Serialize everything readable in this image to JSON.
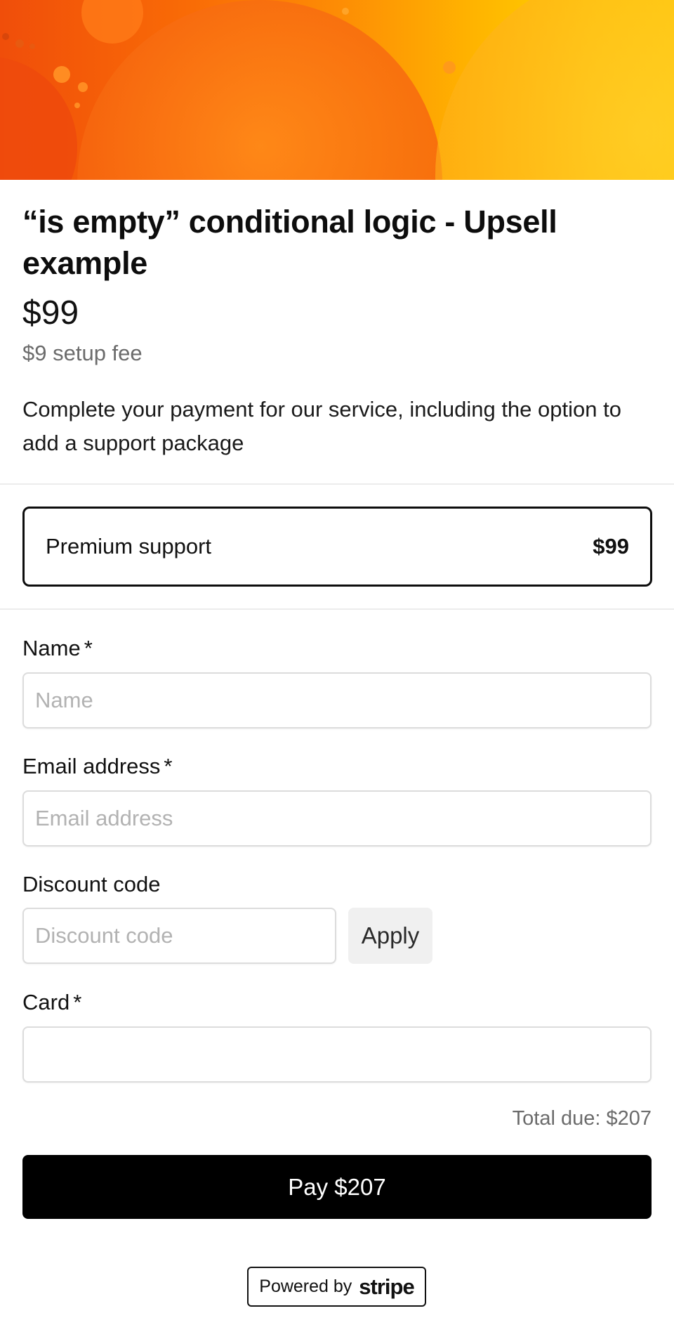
{
  "product": {
    "title": "“is empty” conditional logic - Upsell example",
    "price": "$99",
    "setup_fee": "$9 setup fee",
    "description": "Complete your payment for our service, including the option to add a support package"
  },
  "upsell": {
    "label": "Premium support",
    "price": "$99"
  },
  "form": {
    "name": {
      "label": "Name",
      "required_mark": "*",
      "placeholder": "Name",
      "value": ""
    },
    "email": {
      "label": "Email address",
      "required_mark": "*",
      "placeholder": "Email address",
      "value": ""
    },
    "discount": {
      "label": "Discount code",
      "placeholder": "Discount code",
      "value": "",
      "apply_label": "Apply"
    },
    "card": {
      "label": "Card",
      "required_mark": "*"
    }
  },
  "summary": {
    "total_due": "Total due: $207"
  },
  "pay_button": {
    "label": "Pay $207"
  },
  "footer": {
    "powered_by": "Powered by",
    "brand": "stripe"
  },
  "colors": {
    "hero_gradient": [
      "#f04e0a",
      "#fd8c05",
      "#ffe100"
    ],
    "pay_button_bg": "#000000",
    "muted_text": "#6b6b6b"
  }
}
